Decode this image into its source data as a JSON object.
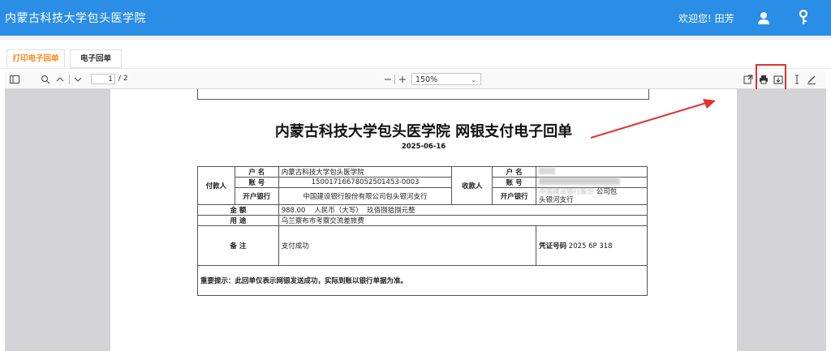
{
  "header": {
    "title": "内蒙古科技大学包头医学院",
    "welcome": "欢迎您! 田芳"
  },
  "tabs": [
    {
      "label": "打印电子回单"
    },
    {
      "label": "电子回单"
    }
  ],
  "pdf_toolbar": {
    "page_current": "1",
    "page_total": "/ 2",
    "zoom": "150%"
  },
  "receipt": {
    "title": "内蒙古科技大学包头医学院 网银支付电子回单",
    "date": "2025-06-16",
    "payer_label": "付款人",
    "payee_label": "收款人",
    "name_label": "户 名",
    "account_label": "账 号",
    "bank_label": "开户银行",
    "payer_name": "内蒙古科技大学包头医学院",
    "payer_account": "15001716678052501453-0003",
    "payer_bank": "中国建设银行股份有限公司包头银河支行",
    "payee_bank_a": "中国建设银行股份",
    "payee_bank_b": "公司包",
    "payee_bank_c": "头银河支行",
    "amount_label": "金 额",
    "amount_value": "988.00    人民币（大写）  玖佰捌拾捌元整",
    "purpose_label": "用 途",
    "purpose_value": "乌兰察布市考察交流差旅费",
    "remark_label": "备 注",
    "remark_value": "支付成功",
    "voucher_label": "凭证号码",
    "voucher_value": "2025 6P 318",
    "notice": "重要提示：此回单仅表示网银发送成功，实际到账以银行单据为准。"
  },
  "colors": {
    "topbar": "#2b8ee6",
    "active_tab": "#f28a1e",
    "highlight": "#e53030"
  }
}
